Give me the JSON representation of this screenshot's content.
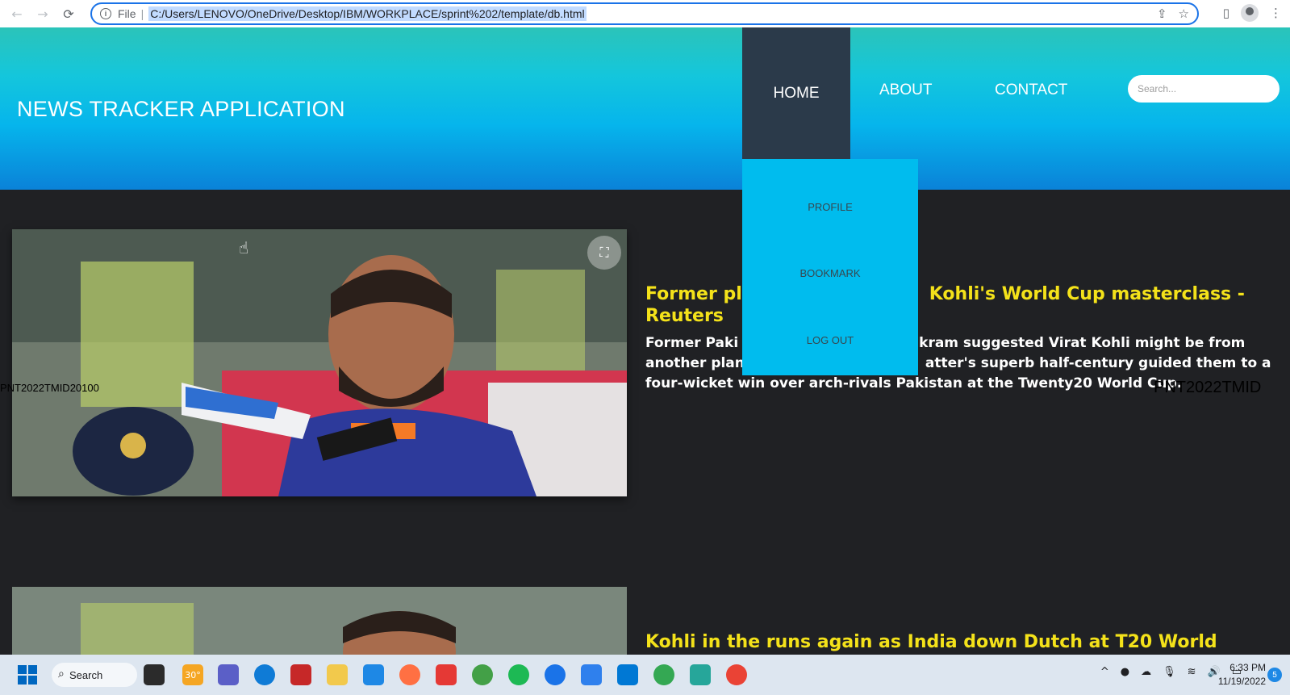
{
  "browser": {
    "back_icon": "←",
    "forward_icon": "→",
    "reload_icon": "⟳",
    "info_icon": "i",
    "scheme": "File",
    "url": "C:/Users/LENOVO/OneDrive/Desktop/IBM/WORKPLACE/sprint%202/template/db.html",
    "share_icon": "⇪",
    "star_icon": "☆",
    "sidepanel_icon": "▯",
    "menu_icon": "⋮"
  },
  "header": {
    "title": "NEWS TRACKER APPLICATION",
    "nav": {
      "home": "HOME",
      "about": "ABOUT",
      "contact": "CONTACT"
    },
    "search_placeholder": "Search..."
  },
  "dropdown": {
    "items": [
      "PROFILE",
      "BOOKMARK",
      "LOG OUT"
    ]
  },
  "articles": [
    {
      "headline_part1": "Former pl",
      "headline_part2": "Kohli's World Cup masterclass -",
      "headline_line2": "Reuters",
      "summary_l1a": "Former Paki",
      "summary_l1b": "kram suggested Virat Kohli might be from",
      "summary_l2a": "another plan",
      "summary_l2b": "atter's superb half-century guided them to a",
      "summary_l3": "four-wicket win over arch-rivals Pakistan at the Twenty20 World Cup."
    },
    {
      "headline": "Kohli in the runs again as India down Dutch at T20 World"
    }
  ],
  "watermark": {
    "left": "PNT2022TMID20100",
    "right": "PNT2022TMID"
  },
  "lens_icon": "⛶",
  "cursor_icon": "☝",
  "taskbar": {
    "search_label": "Search",
    "search_icon": "⌕",
    "weather": "30°",
    "tray_up_icon": "^",
    "time": "6:33 PM",
    "date": "11/19/2022",
    "notifications": "5"
  }
}
